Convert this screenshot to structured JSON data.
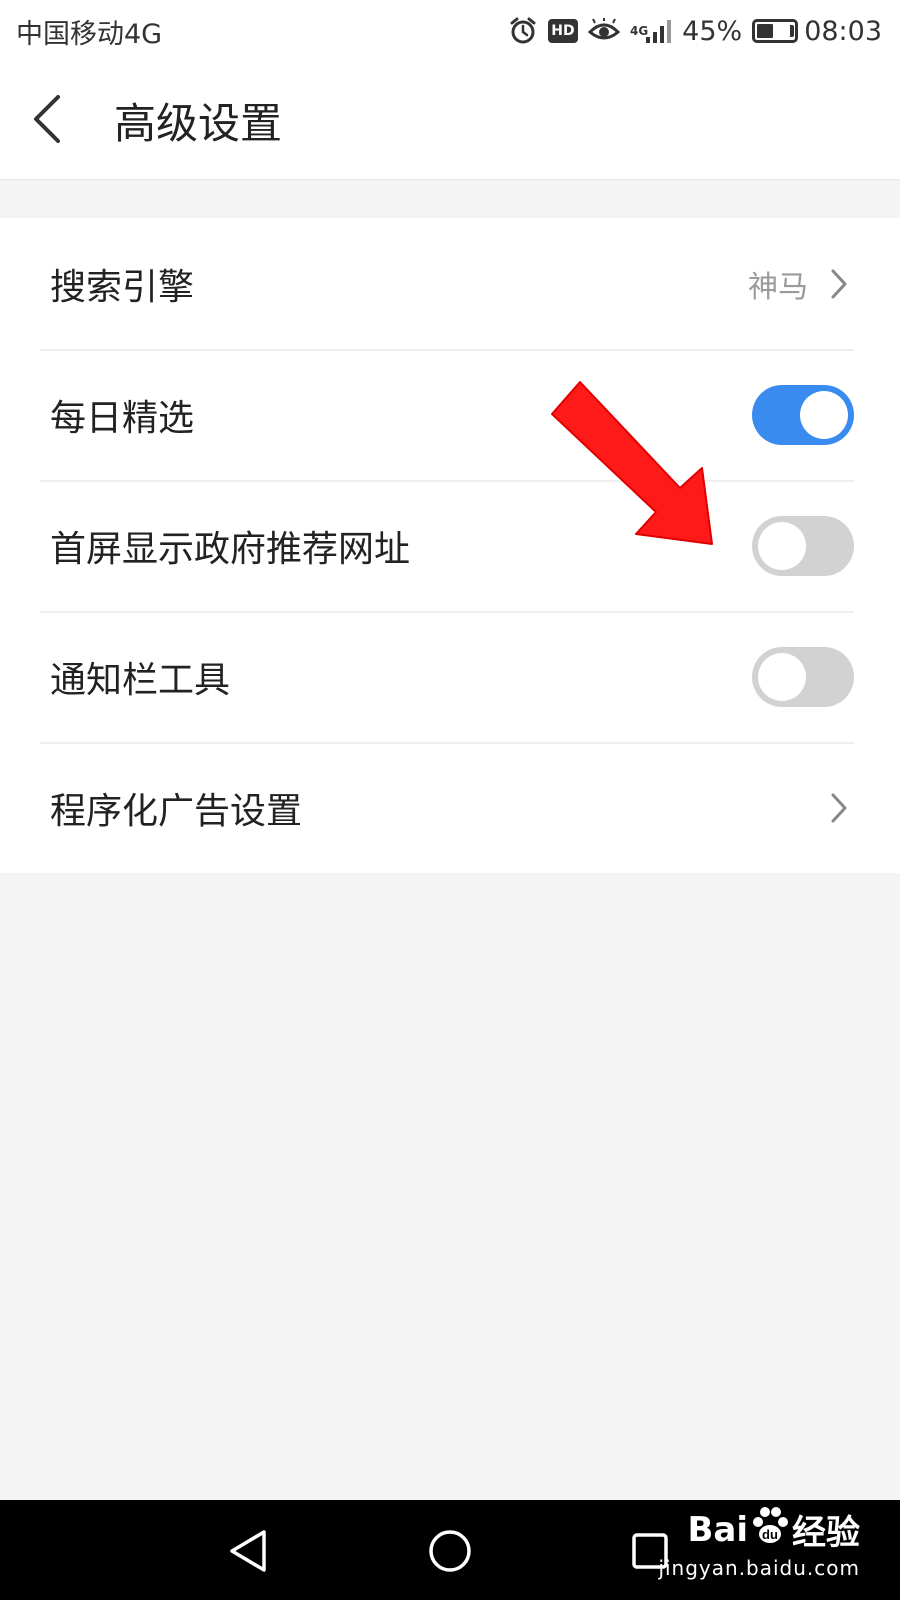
{
  "status_bar": {
    "carrier": "中国移动4G",
    "network_type": "4G",
    "battery": "45%",
    "battery_level": 0.45,
    "time": "08:03",
    "icons": [
      "alarm-icon",
      "hd-icon",
      "eye-comfort-icon",
      "signal-icon",
      "battery-icon"
    ]
  },
  "header": {
    "back_icon": "chevron-left-icon",
    "title": "高级设置"
  },
  "settings": [
    {
      "label": "搜索引擎",
      "value": "神马",
      "control": "chevron"
    },
    {
      "label": "每日精选",
      "control": "toggle",
      "on": true
    },
    {
      "label": "首屏显示政府推荐网址",
      "control": "toggle",
      "on": false
    },
    {
      "label": "通知栏工具",
      "control": "toggle",
      "on": false
    },
    {
      "label": "程序化广告设置",
      "control": "chevron"
    }
  ],
  "annotation": {
    "type": "red-arrow",
    "points_to": "首屏显示政府推荐网址"
  },
  "nav_bar": {
    "buttons": [
      "back-triangle-icon",
      "home-circle-icon",
      "recent-square-icon"
    ]
  },
  "watermark": {
    "logo_text_1": "Bai",
    "logo_text_2": "经验",
    "url": "jingyan.baidu.com"
  },
  "colors": {
    "accent": "#3a8bf0",
    "toggle_off": "#d2d2d2",
    "background": "#f4f4f4",
    "arrow": "#ff1a1a"
  }
}
